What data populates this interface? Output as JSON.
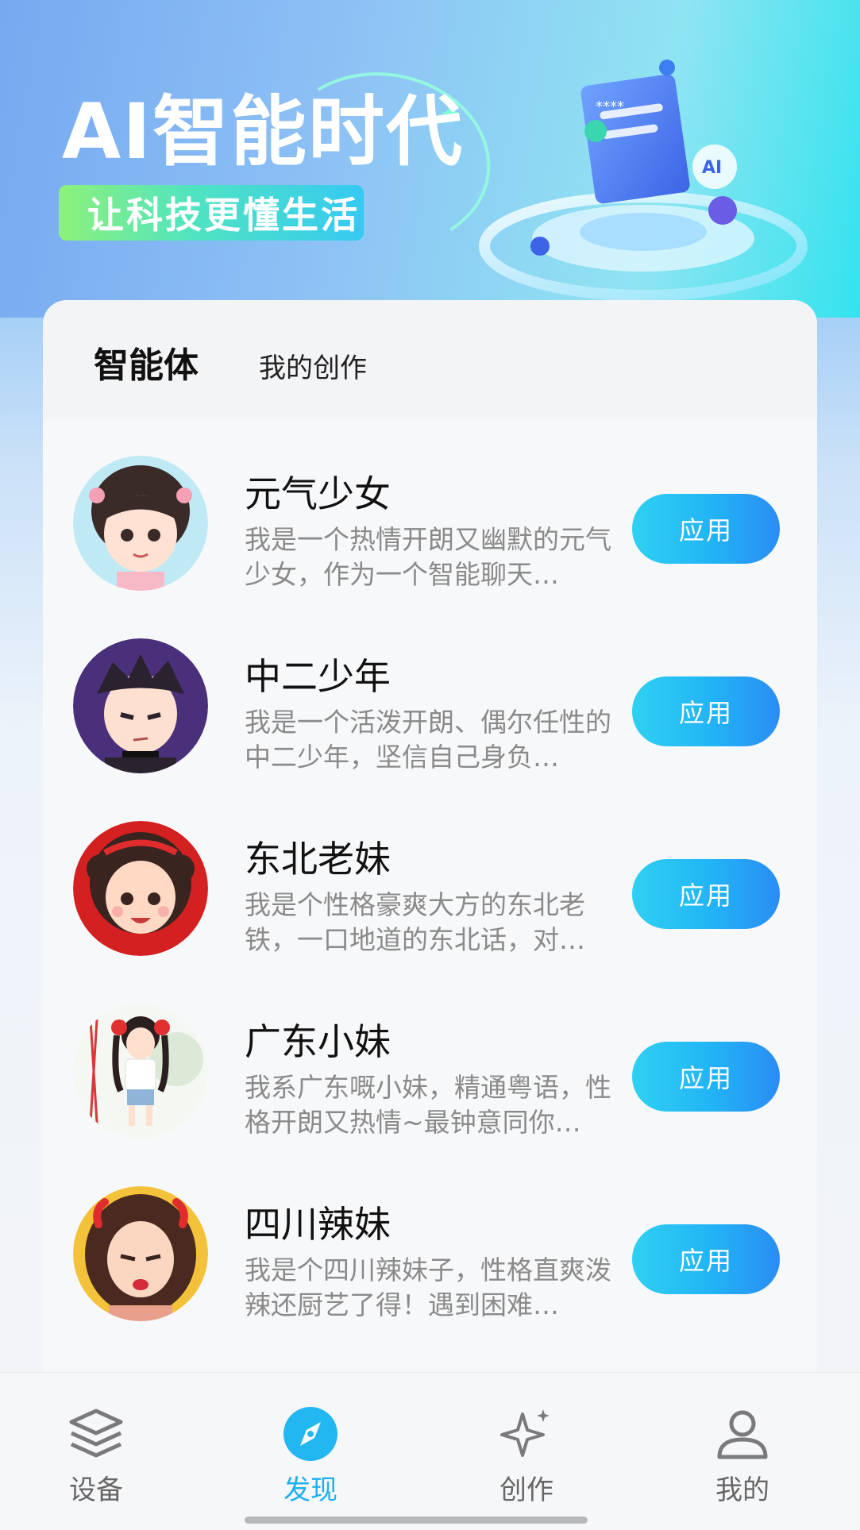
{
  "banner": {
    "title": "AI智能时代",
    "subtitle": "让科技更懂生活",
    "illustration_badge": "AI",
    "illustration_stars": "****"
  },
  "tabs": [
    {
      "label": "智能体",
      "active": true
    },
    {
      "label": "我的创作",
      "active": false
    }
  ],
  "agents": [
    {
      "name": "元气少女",
      "description": "我是一个热情开朗又幽默的元气少女，作为一个智能聊天…",
      "action": "应用",
      "avatar_icon": "girl-pigtails-avatar"
    },
    {
      "name": "中二少年",
      "description": "我是一个活泼开朗、偶尔任性的中二少年，坚信自己身负…",
      "action": "应用",
      "avatar_icon": "boy-avatar"
    },
    {
      "name": "东北老妹",
      "description": "我是个性格豪爽大方的东北老铁，一口地道的东北话，对…",
      "action": "应用",
      "avatar_icon": "curly-girl-avatar"
    },
    {
      "name": "广东小妹",
      "description": "我系广东嘅小妹，精通粤语，性格开朗又热情~最钟意同你…",
      "action": "应用",
      "avatar_icon": "canton-tower-girl-avatar"
    },
    {
      "name": "四川辣妹",
      "description": "我是个四川辣妹子，性格直爽泼辣还厨艺了得！遇到困难…",
      "action": "应用",
      "avatar_icon": "chili-girl-avatar"
    }
  ],
  "bottom_nav": [
    {
      "label": "设备",
      "icon": "layers-icon",
      "active": false
    },
    {
      "label": "发现",
      "icon": "compass-icon",
      "active": true
    },
    {
      "label": "创作",
      "icon": "sparkle-icon",
      "active": false
    },
    {
      "label": "我的",
      "icon": "user-icon",
      "active": false
    }
  ],
  "colors": {
    "accent": "#1fb0ef",
    "button_gradient_start": "#2fd1f2",
    "button_gradient_end": "#2a8cf5"
  }
}
